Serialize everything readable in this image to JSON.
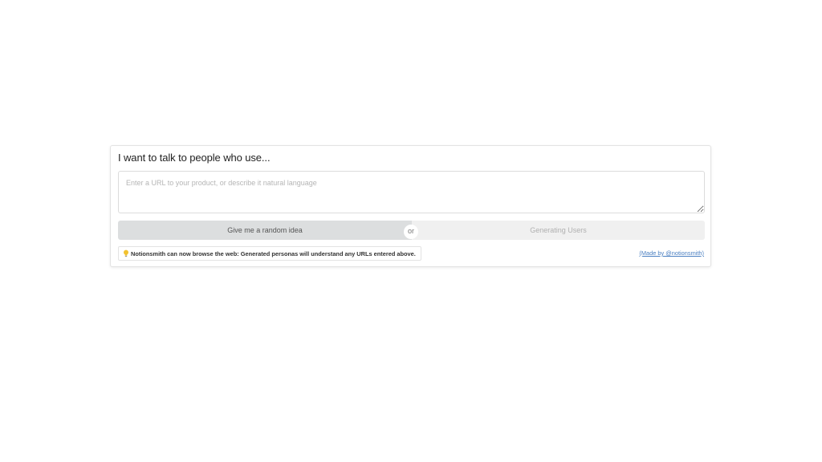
{
  "form": {
    "heading": "I want to talk to people who use...",
    "input_placeholder": "Enter a URL to your product, or describe it natural language",
    "input_value": "",
    "random_idea_label": "Give me a random idea",
    "or_label": "or",
    "generating_label": "Generating Users"
  },
  "notice": {
    "icon": "lightbulb-icon",
    "text": "Notionsmith can now browse the web: Generated personas will understand any URLs entered above."
  },
  "footer": {
    "made_by": "(Made by @notionsmith)"
  },
  "colors": {
    "random_button_bg": "#dcdedf",
    "generate_button_bg": "#f0f0f0",
    "link": "#4a7fc1",
    "bulb": "#f2c230"
  }
}
